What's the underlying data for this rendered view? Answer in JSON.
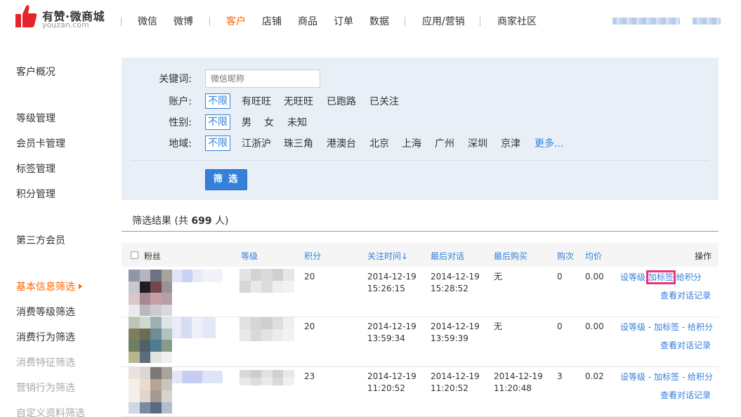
{
  "header": {
    "brand": "有赞·微商城",
    "domain": "youzan.com",
    "nav": [
      "微信",
      "微博",
      "客户",
      "店铺",
      "商品",
      "订单",
      "数据",
      "应用/营销",
      "商家社区"
    ],
    "active_nav": "客户"
  },
  "sidebar": {
    "items": [
      {
        "label": "客户概况"
      },
      {
        "label": "等级管理"
      },
      {
        "label": "会员卡管理"
      },
      {
        "label": "标签管理"
      },
      {
        "label": "积分管理"
      },
      {
        "label": "第三方会员"
      },
      {
        "label": "基本信息筛选"
      },
      {
        "label": "消费等级筛选"
      },
      {
        "label": "消费行为筛选"
      },
      {
        "label": "消费特征筛选"
      },
      {
        "label": "营销行为筛选"
      },
      {
        "label": "自定义资料筛选"
      }
    ],
    "active": "基本信息筛选"
  },
  "filter": {
    "keyword_label": "关键词:",
    "keyword_placeholder": "微信昵称",
    "account_label": "账户:",
    "account_options": [
      "不限",
      "有旺旺",
      "无旺旺",
      "已跑路",
      "已关注"
    ],
    "gender_label": "性别:",
    "gender_options": [
      "不限",
      "男",
      "女",
      "未知"
    ],
    "region_label": "地域:",
    "region_options": [
      "不限",
      "江浙沪",
      "珠三角",
      "港澳台",
      "北京",
      "上海",
      "广州",
      "深圳",
      "京津"
    ],
    "region_more": "更多...",
    "submit_label": "筛 选"
  },
  "results": {
    "title_prefix": "筛选结果 (共 ",
    "count": "699",
    "title_suffix": " 人)",
    "columns": {
      "fans": "粉丝",
      "level": "等级",
      "points": "积分",
      "follow_time": "关注时间",
      "sort_arrow": "↓",
      "last_chat": "最后对话",
      "last_purchase": "最后购买",
      "purchase_count": "购次",
      "avg_price": "均价",
      "actions": "操作"
    },
    "rows": [
      {
        "points": "20",
        "follow_date": "2014-12-19",
        "follow_time": "15:26:15",
        "chat_date": "2014-12-19",
        "chat_time": "15:28:52",
        "purchase_date": "无",
        "purchase_time": "",
        "count": "0",
        "avg": "0.00"
      },
      {
        "points": "20",
        "follow_date": "2014-12-19",
        "follow_time": "13:59:34",
        "chat_date": "2014-12-19",
        "chat_time": "13:59:39",
        "purchase_date": "无",
        "purchase_time": "",
        "count": "0",
        "avg": "0.00"
      },
      {
        "points": "23",
        "follow_date": "2014-12-19",
        "follow_time": "11:20:52",
        "chat_date": "2014-12-19",
        "chat_time": "11:20:52",
        "purchase_date": "2014-12-19",
        "purchase_time": "11:20:48",
        "count": "3",
        "avg": "0.02"
      }
    ],
    "actions": {
      "set_level": "设等级",
      "add_tag": "加标签",
      "give_points": "给积分",
      "view_chat": "查看对话记录",
      "dash": "-"
    }
  }
}
